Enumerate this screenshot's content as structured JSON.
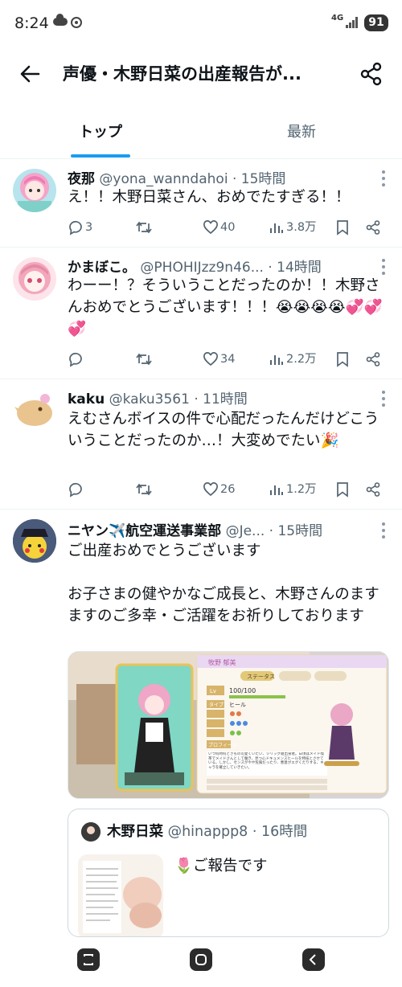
{
  "status_bar": {
    "time": "8:24",
    "network": "4G",
    "battery": "91"
  },
  "header": {
    "title": "声優・木野日菜の出産報告が..."
  },
  "tabs": [
    {
      "label": "トップ"
    },
    {
      "label": "最新"
    }
  ],
  "tweets": [
    {
      "name": "夜那",
      "handle": "@yona_wanndahoi",
      "time": "· 15時間",
      "text": "え！！木野日菜さん、おめでたすぎる！！",
      "replies": "3",
      "likes": "40",
      "views": "3.8万"
    },
    {
      "name": "かまぼこ。",
      "handle": "@PHOHIJzz9n46...",
      "time": "· 14時間",
      "text": "わーー！？そういうことだったのか！！木野さんおめでとうございます！！！😭😭😭😭💞💞💞",
      "likes": "34",
      "views": "2.2万"
    },
    {
      "name": "kaku",
      "handle": "@kaku3561",
      "time": "· 11時間",
      "text": "えむさんボイスの件で心配だったんだけどこういうことだったのか…！大変めでたい🎉",
      "likes": "26",
      "views": "1.2万"
    },
    {
      "name": "ニヤン✈️航空運送事業部",
      "handle": "@Je...",
      "time": "· 15時間",
      "text": "ご出産おめでとうございます\n\nお子さまの健やかなご成長と、木野さんのますますのご多幸・ご活躍をお祈りしております",
      "media": {
        "character_name": "牧野 郁美",
        "tab_status": "ステータス",
        "level_label": "Lv",
        "hp": "100/100",
        "type_label": "タイプ",
        "type_value": "ヒール",
        "profile_label": "プロフィール",
        "profile_text": "いつ何時何ときもの可愛くいたい、ジリッグ組出身者。日頃はメイド喫茶でメイドさんとして働き、見つ心ドキュメンスヒールを特技とさせている。しかし、センスがやや危険だったり、悪意がエグくたりする、キャラを確立していきたい。"
      },
      "quote": {
        "name": "木野日菜",
        "handle": "@hinappp8",
        "time": "· 16時間",
        "text": "🌷ご報告です"
      }
    }
  ],
  "colors": {
    "accent": "#1d9bf0",
    "secondary_text": "#536471",
    "primary_text": "#0f1419"
  }
}
